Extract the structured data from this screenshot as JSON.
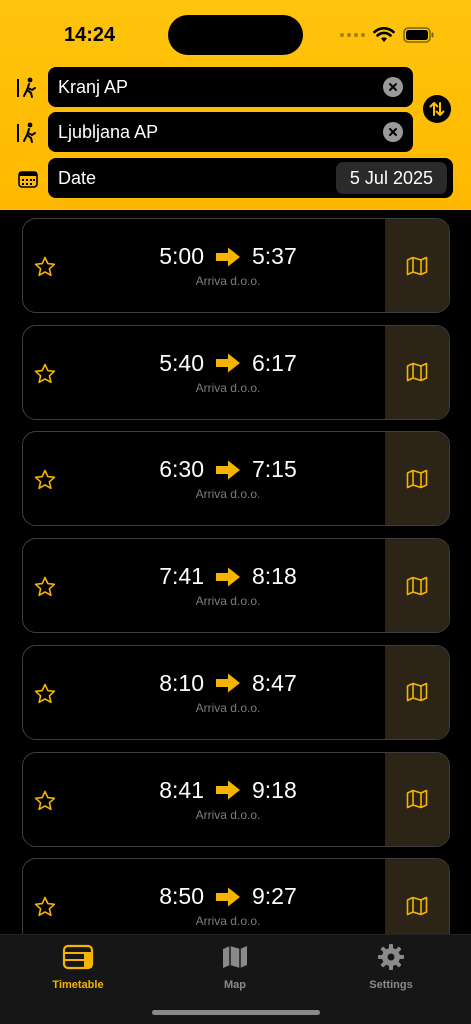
{
  "status_bar": {
    "time": "14:24"
  },
  "search": {
    "from": {
      "value": "Kranj AP"
    },
    "to": {
      "value": "Ljubljana AP"
    },
    "date": {
      "label": "Date",
      "value": "5 Jul 2025"
    }
  },
  "colors": {
    "accent": "#FFC107",
    "card_border": "#3e3e3e",
    "map_pane": "#2c2416"
  },
  "departures": [
    {
      "depart": "5:00",
      "arrive": "5:37",
      "operator": "Arriva d.o.o."
    },
    {
      "depart": "5:40",
      "arrive": "6:17",
      "operator": "Arriva d.o.o."
    },
    {
      "depart": "6:30",
      "arrive": "7:15",
      "operator": "Arriva d.o.o."
    },
    {
      "depart": "7:41",
      "arrive": "8:18",
      "operator": "Arriva d.o.o."
    },
    {
      "depart": "8:10",
      "arrive": "8:47",
      "operator": "Arriva d.o.o."
    },
    {
      "depart": "8:41",
      "arrive": "9:18",
      "operator": "Arriva d.o.o."
    },
    {
      "depart": "8:50",
      "arrive": "9:27",
      "operator": "Arriva d.o.o."
    }
  ],
  "tabs": [
    {
      "label": "Timetable",
      "icon": "timetable-icon",
      "active": true
    },
    {
      "label": "Map",
      "icon": "map-icon",
      "active": false
    },
    {
      "label": "Settings",
      "icon": "gear-icon",
      "active": false
    }
  ]
}
